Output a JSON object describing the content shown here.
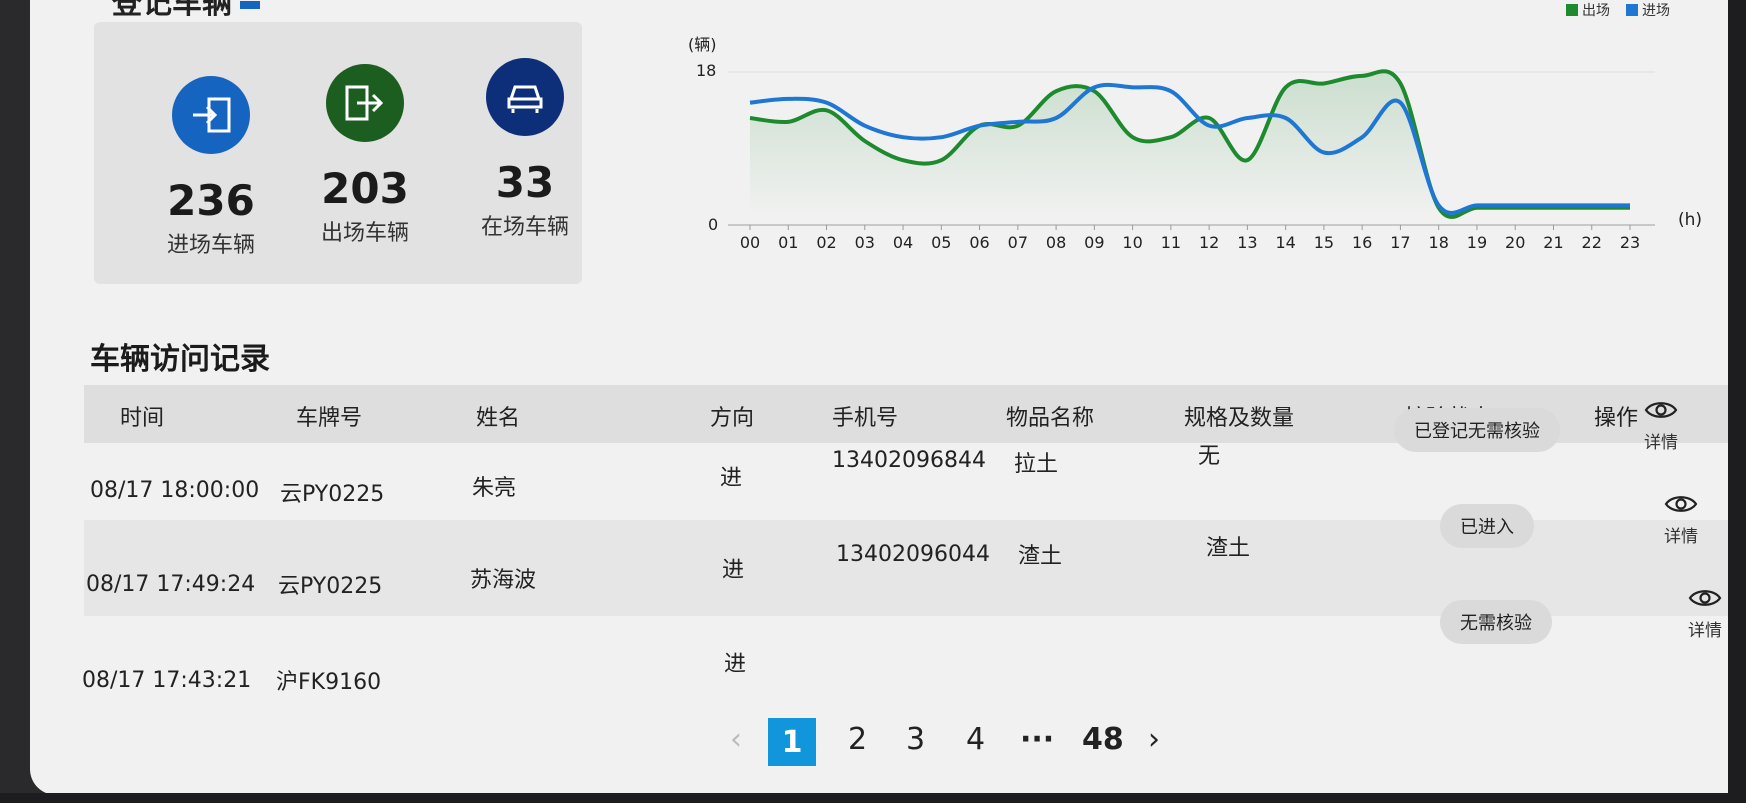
{
  "section_title": "登记车辆",
  "stats": [
    {
      "value": "236",
      "label": "进场车辆",
      "icon": "enter-icon",
      "color": "#1565c0"
    },
    {
      "value": "203",
      "label": "出场车辆",
      "icon": "exit-icon",
      "color": "#1b5e20"
    },
    {
      "value": "33",
      "label": "在场车辆",
      "icon": "car-icon",
      "color": "#0d2f7a"
    }
  ],
  "chart_data": {
    "type": "line",
    "y_unit_label": "(辆)",
    "x_unit_label": "(h)",
    "ylim": [
      0,
      18
    ],
    "yticks": [
      "0",
      "18"
    ],
    "categories": [
      "00",
      "01",
      "02",
      "03",
      "04",
      "05",
      "06",
      "07",
      "08",
      "09",
      "10",
      "11",
      "12",
      "13",
      "14",
      "15",
      "16",
      "17",
      "18",
      "19",
      "20",
      "21",
      "22",
      "23"
    ],
    "series": [
      {
        "name": "出场",
        "color": "#1e8a2e",
        "values": [
          12,
          11.5,
          13,
          9,
          6.5,
          6.5,
          11,
          11,
          15.5,
          15.5,
          9.5,
          9.5,
          12,
          6.5,
          16,
          16.5,
          17.5,
          16.5,
          0.3,
          0.3,
          0.3,
          0.3,
          0.3,
          0.3
        ]
      },
      {
        "name": "进场",
        "color": "#1f77d4",
        "values": [
          14,
          14.5,
          14,
          11,
          9.5,
          9.5,
          11,
          11.5,
          12,
          16,
          16,
          15.5,
          11,
          12,
          12,
          7.5,
          9.5,
          14,
          0.6,
          0.6,
          0.6,
          0.6,
          0.6,
          0.6
        ]
      }
    ]
  },
  "records": {
    "title": "车辆访问记录",
    "headers": [
      "时间",
      "车牌号",
      "姓名",
      "方向",
      "手机号",
      "物品名称",
      "规格及数量",
      "核验状态",
      "操作"
    ],
    "rows": [
      {
        "time": "08/17 18:00:00",
        "plate": "云PY0225",
        "name": "朱亮",
        "direction": "进",
        "phone": "13402096844",
        "item": "拉土",
        "spec": "无",
        "status": "已登记无需核验",
        "op": "详情"
      },
      {
        "time": "08/17 17:49:24",
        "plate": "云PY0225",
        "name": "苏海波",
        "direction": "进",
        "phone": "13402096044",
        "item": "渣土",
        "spec": "渣土",
        "status": "已进入",
        "op": "详情"
      },
      {
        "time": "08/17 17:43:21",
        "plate": "沪FK9160",
        "name": "",
        "direction": "进",
        "phone": "",
        "item": "",
        "spec": "",
        "status": "无需核验",
        "op": "详情"
      }
    ]
  },
  "pagination": {
    "prev": "‹",
    "pages": [
      "1",
      "2",
      "3",
      "4"
    ],
    "ellipsis": "···",
    "last": "48",
    "next": "›",
    "current": "1"
  }
}
